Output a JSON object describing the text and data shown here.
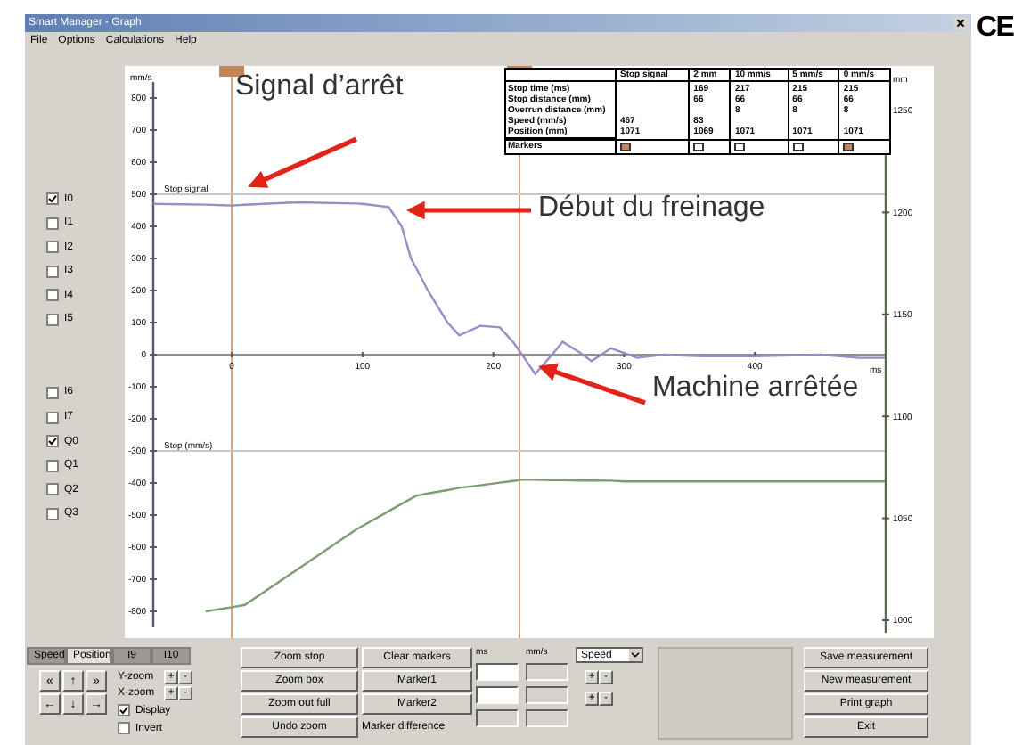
{
  "window": {
    "title": "Smart Manager - Graph"
  },
  "menu": [
    "File",
    "Options",
    "Calculations",
    "Help"
  ],
  "channel_groups": [
    {
      "items": [
        {
          "label": "I0",
          "checked": true
        },
        {
          "label": "I1",
          "checked": false
        },
        {
          "label": "I2",
          "checked": false
        },
        {
          "label": "I3",
          "checked": false
        },
        {
          "label": "I4",
          "checked": false
        },
        {
          "label": "I5",
          "checked": false
        }
      ]
    },
    {
      "items": [
        {
          "label": "I6",
          "checked": false
        },
        {
          "label": "I7",
          "checked": false
        },
        {
          "label": "Q0",
          "checked": true
        },
        {
          "label": "Q1",
          "checked": false
        },
        {
          "label": "Q2",
          "checked": false
        },
        {
          "label": "Q3",
          "checked": false
        }
      ]
    }
  ],
  "graph": {
    "chart_data": {
      "type": "line",
      "xlabel": "ms",
      "ylabel": "mm/s",
      "xlim": [
        -60,
        500
      ],
      "ylim": [
        -850,
        850
      ],
      "x": [
        -60,
        -20,
        0,
        10,
        50,
        95,
        100,
        120,
        130,
        137,
        141,
        150,
        165,
        174,
        190,
        205,
        215,
        222,
        232,
        245,
        253,
        265,
        275,
        290,
        300,
        310,
        330,
        360,
        400,
        450,
        480,
        500
      ],
      "series": [
        {
          "color": "#9a8cc4",
          "values": [
            470,
            468,
            465,
            467,
            475,
            471,
            470,
            460,
            400,
            300,
            270,
            200,
            100,
            60,
            90,
            85,
            40,
            0,
            -60,
            0,
            40,
            10,
            -20,
            20,
            5,
            -10,
            0,
            -5,
            -5,
            0,
            -10,
            -10
          ]
        },
        {
          "color": "#7f9c74",
          "values": [
            null,
            -800,
            -787,
            -780,
            -670,
            -545,
            -534,
            -488,
            -465,
            -449,
            -440,
            -433,
            -422,
            -415,
            -407,
            -399,
            -394,
            -390,
            -390,
            -391,
            -391,
            -392,
            -392,
            -393,
            -395,
            -395,
            -395,
            -395,
            -395,
            -395,
            -395,
            -395
          ]
        }
      ],
      "xticks": [
        0,
        100,
        200,
        300,
        400
      ],
      "yticks": [
        800,
        700,
        600,
        500,
        400,
        300,
        200,
        100,
        0,
        -100,
        -200,
        -300,
        -400,
        -500,
        -600,
        -700,
        -800
      ],
      "ref_lines": [
        {
          "axis": "x",
          "value": 0
        },
        {
          "axis": "x",
          "value": 220
        },
        {
          "axis": "y",
          "value": 500,
          "label": "Stop signal"
        },
        {
          "axis": "y",
          "value": -300,
          "label": "Stop (mm/s)"
        }
      ]
    },
    "right_axis": {
      "unit": "mm",
      "ticks": [
        "1250",
        "1200",
        "1150",
        "1100",
        "1050",
        "1000"
      ]
    },
    "table": {
      "columns": [
        "Stop signal",
        "2 mm",
        "10 mm/s",
        "5 mm/s",
        "0 mm/s"
      ],
      "rows": [
        {
          "label": "Stop time (ms)",
          "cells": [
            null,
            "169",
            "217",
            "215",
            "215"
          ]
        },
        {
          "label": "Stop distance (mm)",
          "cells": [
            null,
            "66",
            "66",
            "66",
            "66"
          ]
        },
        {
          "label": "Overrun distance (mm)",
          "cells": [
            null,
            null,
            "8",
            "8",
            "8"
          ]
        },
        {
          "label": "Speed (mm/s)",
          "cells": [
            "467",
            "83",
            null,
            null,
            null
          ]
        },
        {
          "label": "Position (mm)",
          "cells": [
            "1071",
            "1069",
            "1071",
            "1071",
            "1071"
          ]
        }
      ],
      "markers": {
        "label": "Markers",
        "toggles": [
          {
            "selected": true
          },
          {
            "selected": false
          },
          {
            "selected": false
          },
          {
            "selected": false
          },
          {
            "selected": true
          }
        ]
      }
    },
    "callouts": [
      "Signal d’arrêt",
      "Début du freinage",
      "Machine arrêtée"
    ]
  },
  "bottom_panel": {
    "tabs": [
      {
        "label": "Speed",
        "selected": false
      },
      {
        "label": "Position",
        "selected": true
      },
      {
        "label": "I9",
        "selected": false
      },
      {
        "label": "I10",
        "selected": false
      }
    ],
    "nav_buttons": [
      "«",
      "↑",
      "»",
      "←",
      "↓",
      "→"
    ],
    "zoom_controls": [
      {
        "label": "Y-zoom",
        "plus": "+",
        "minus": "-"
      },
      {
        "label": "X-zoom",
        "plus": "+",
        "minus": "-"
      }
    ],
    "options": [
      {
        "label": "Display",
        "checked": true
      },
      {
        "label": "Invert",
        "checked": false
      }
    ],
    "view_buttons": [
      "Zoom stop",
      "Zoom box",
      "Zoom out full",
      "Undo zoom"
    ],
    "marker_buttons": [
      "Clear markers",
      "Marker1",
      "Marker2"
    ],
    "marker_difference_label": "Marker difference",
    "ms_label": "ms",
    "ms_fields": [
      {
        "disabled": false
      },
      {
        "disabled": false
      },
      {
        "disabled": true
      }
    ],
    "speed_label": "mm/s",
    "speed_fields": [
      {
        "disabled": true
      },
      {
        "disabled": true
      },
      {
        "disabled": true
      }
    ],
    "unit_select": {
      "value": "Speed"
    },
    "steppers": [
      {
        "plus": "+",
        "minus": "-"
      },
      {
        "plus": "+",
        "minus": "-"
      }
    ],
    "actions": [
      "Save measurement",
      "New measurement",
      "Print graph",
      "Exit"
    ]
  },
  "logo_mark": "CE"
}
